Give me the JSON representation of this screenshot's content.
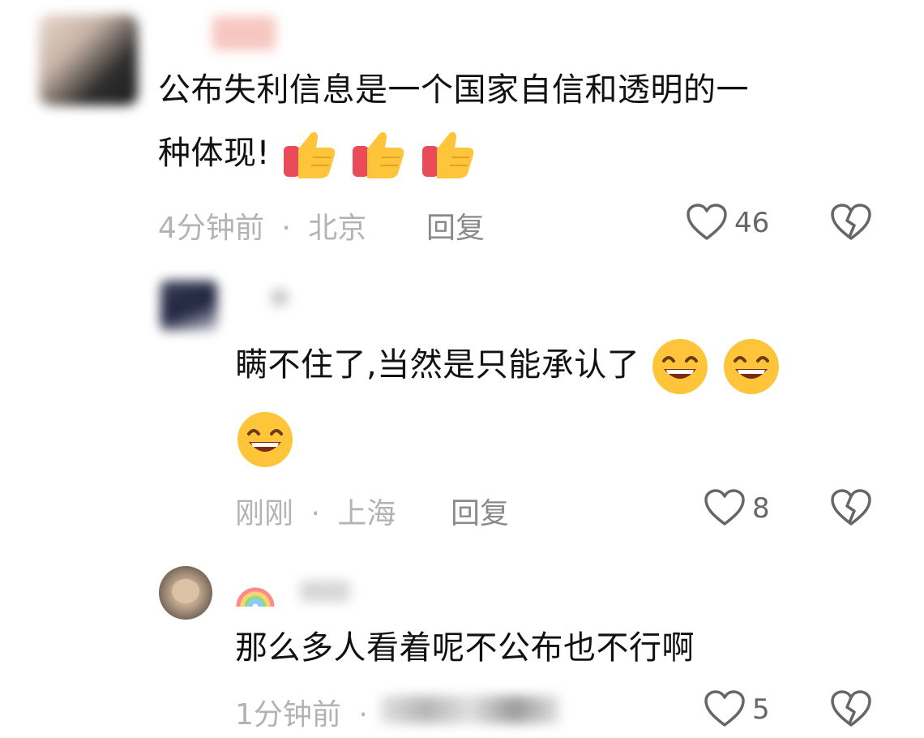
{
  "comments": [
    {
      "text_line1": "公布失利信息是一个国家自信和透明的一",
      "text_line2": "种体现!",
      "time": "4分钟前",
      "location": "北京",
      "reply": "回复",
      "likes": "46",
      "emoji": "thumbs-up"
    },
    {
      "text_line1": "瞒不住了,当然是只能承认了",
      "time": "刚刚",
      "location": "上海",
      "reply": "回复",
      "likes": "8",
      "emoji": "grinning-face"
    },
    {
      "text_line1": "那么多人看着呢不公布也不行啊",
      "time": "1分钟前",
      "likes": "5",
      "username_icon": "rainbow"
    }
  ],
  "separator": "·",
  "colors": {
    "text": "#111111",
    "meta": "#b3b3b3",
    "reply": "#8a8a8a",
    "icon": "#666666"
  }
}
